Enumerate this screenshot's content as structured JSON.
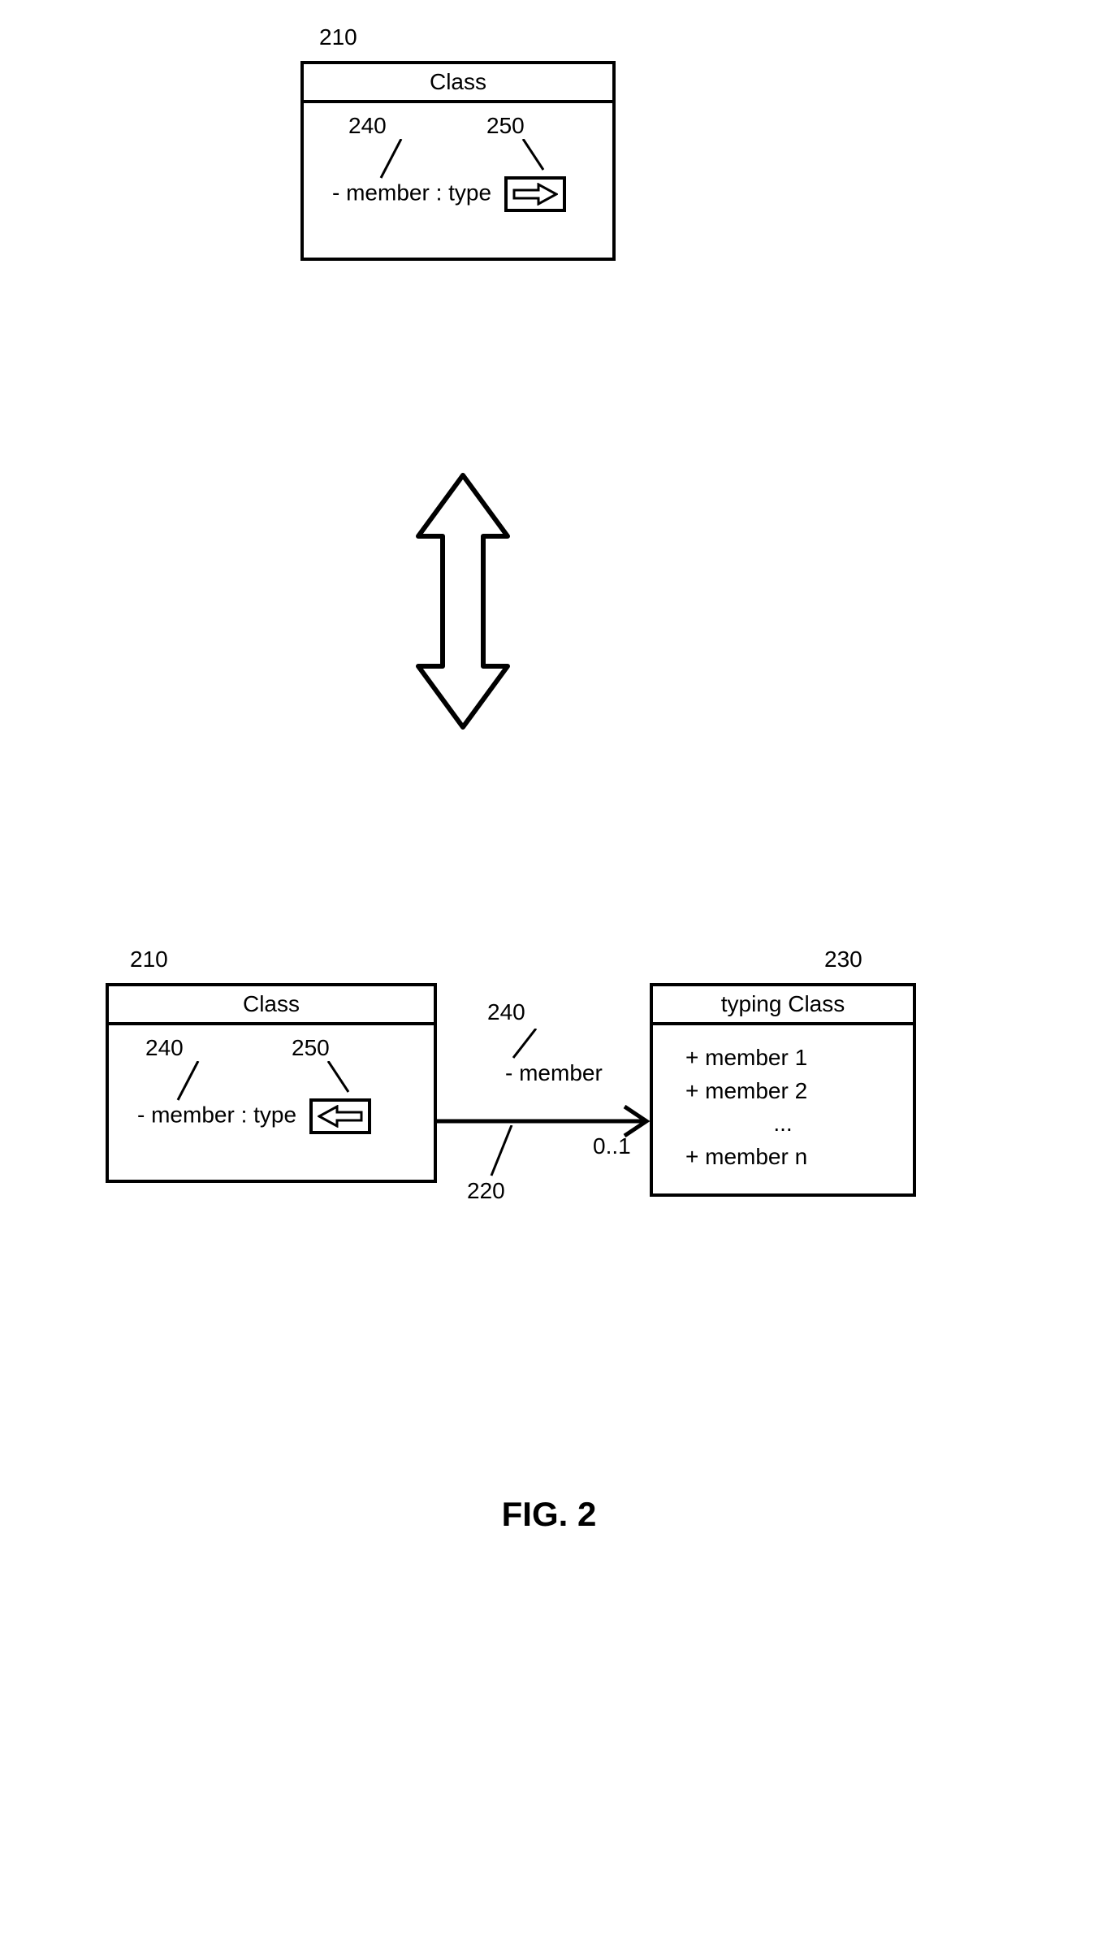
{
  "figure_caption": "FIG. 2",
  "top": {
    "ref_box": "210",
    "title": "Class",
    "ref_member": "240",
    "ref_button": "250",
    "member_text": "- member : type"
  },
  "bottom": {
    "left": {
      "ref_box": "210",
      "title": "Class",
      "ref_member": "240",
      "ref_button": "250",
      "member_text": "- member : type"
    },
    "assoc": {
      "ref_label": "240",
      "label": "- member",
      "ref_line": "220",
      "multiplicity": "0..1"
    },
    "right": {
      "ref_box": "230",
      "title": "typing Class",
      "members": [
        "+ member 1",
        "+ member 2",
        "...",
        "+ member n"
      ]
    }
  }
}
